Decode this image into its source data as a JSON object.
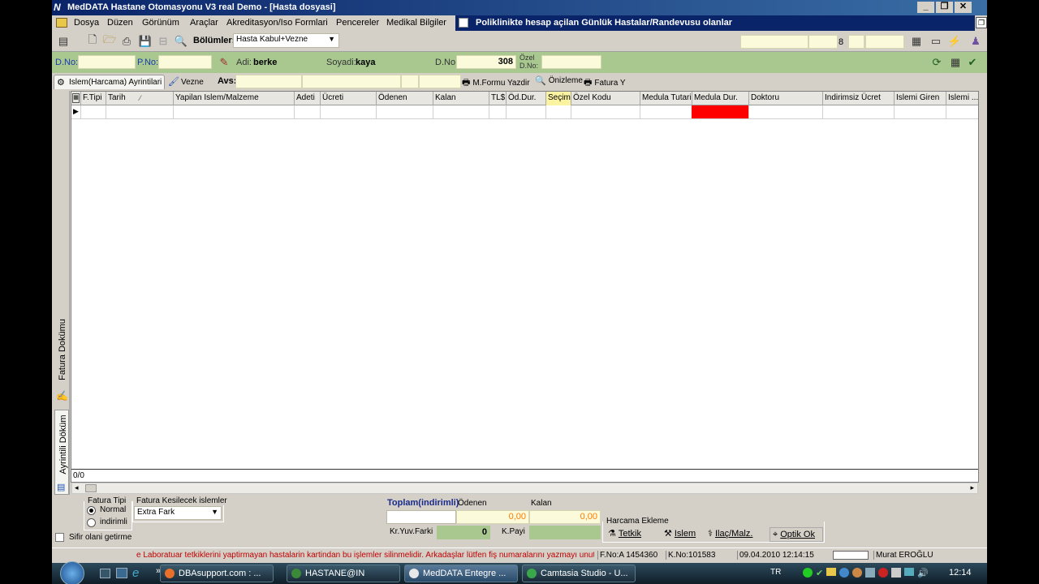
{
  "window": {
    "title": "MedDATA Hastane  Otomasyonu V3  real Demo  - [Hasta dosyasi]"
  },
  "menu": [
    "Dosya",
    "Düzen",
    "Görünüm",
    "Araçlar",
    "Akreditasyon/Iso Formlari",
    "Pencereler",
    "Medikal Bilgiler"
  ],
  "doc_tab": {
    "label": "Poliklinikte hesap açilan Günlük Hastalar/Randevusu olanlar"
  },
  "toolbar": {
    "bolumler_label": "Bölümler:",
    "bolumler_value": "Hasta Kabul+Vezne",
    "small_value": "8"
  },
  "patient": {
    "dno_label": "D.No:",
    "pno_label": "P.No:",
    "adi_label": "Adi:",
    "adi_value": "berke",
    "soyadi_label": "Soyadi:",
    "soyadi_value": "kaya",
    "dno2_label": "D.No:",
    "dno2_value": "308",
    "ozel_label1": "Özel",
    "ozel_label2": "D.No:"
  },
  "tabs": {
    "islem": "Islem(Harcama) Ayrintilari",
    "vezne": "Vezne",
    "avs": "Avs:"
  },
  "actions": {
    "mformu": "M.Formu Yazdir",
    "onizleme": "Önizleme",
    "fatura": "Fatura Y"
  },
  "grid": {
    "columns": [
      "F.Tipi",
      "Tarih",
      "Yapilan Islem/Malzeme",
      "Adeti",
      "Ücreti",
      "Ödenen",
      "Kalan",
      "TL$",
      "Öd.Dur.",
      "Seçim",
      "Özel Kodu",
      "Medula Tutari",
      "Medula Dur.",
      "Doktoru",
      "Indirimsiz Ücret",
      "Islemi Giren",
      "Islemi ..."
    ],
    "sort_marker": "⁄",
    "footer_count": "0/0"
  },
  "side_tabs": {
    "fatura_dokumu": "Fatura Dokümu",
    "ayrintili_dokum": "Ayrintili Döküm"
  },
  "bottom": {
    "fatura_tipi_label": "Fatura Tipi",
    "radio_normal": "Normal",
    "radio_indirimli": "indirimli",
    "kesilecek_label": "Fatura Kesilecek islemler",
    "kesilecek_value": "Extra Fark",
    "sifir_label": "Sifir olani getirme",
    "toplam_label": "Toplam(indirimli)",
    "odenen_label": "Ödenen",
    "kalan_label": "Kalan",
    "odenen_value": "0,00",
    "kalan_value": "0,00",
    "kryuv_label": "Kr.Yuv.Farki",
    "kryuv_value": "0",
    "kpayi_label": "K.Payi",
    "harcama_label": "Harcama Ekleme",
    "tetkik": "Tetkik",
    "islem": "Islem",
    "ilac": "Ilaç/Malz.",
    "optik": "Optik Ok"
  },
  "status": {
    "message": "e Laboratuar tetkiklerini yaptirmayan hastalarin kartindan bu işlemler silinmelidir. Arkadaşlar lütfen fiş numaralarını yazmayı unutmayınız.",
    "fno": "F.No:A 1454360",
    "kno": "K.No:101583",
    "datetime": "09.04.2010 12:14:15",
    "user": "Murat EROĞLU"
  },
  "taskbar": {
    "items": [
      "DBAsupport.com : ...",
      "HASTANE@IN",
      "MedDATA Entegre ...",
      "Camtasia Studio - U..."
    ],
    "lang": "TR",
    "clock": "12:14"
  },
  "colors": {
    "title_bar": "#0a246a",
    "patient_bar": "#a8c890",
    "accent_red": "#ff0000",
    "field_yellow": "#fbfbdb"
  }
}
